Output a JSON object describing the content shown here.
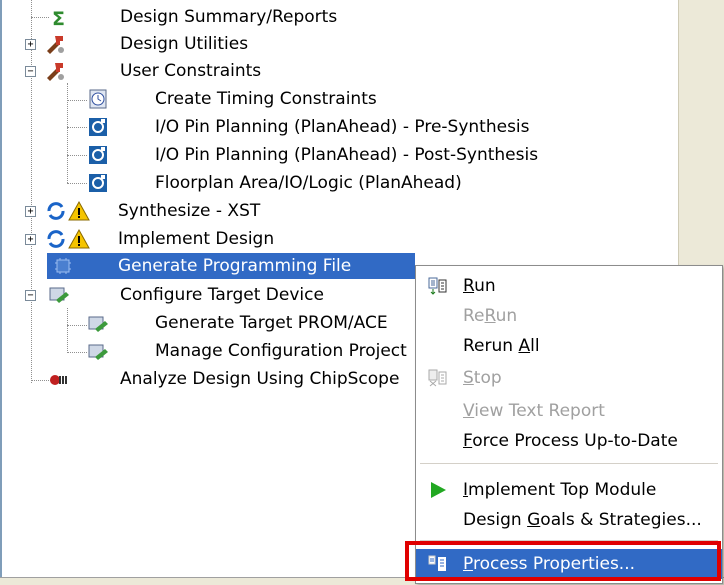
{
  "tree": {
    "items": [
      {
        "label": "Design Summary/Reports",
        "icon": "sigma-icon"
      },
      {
        "label": "Design Utilities",
        "icon": "tools-icon"
      },
      {
        "label": "User Constraints",
        "icon": "tools-icon"
      },
      {
        "label": "Create Timing Constraints",
        "icon": "clock-icon"
      },
      {
        "label": "I/O Pin Planning (PlanAhead) - Pre-Synthesis",
        "icon": "planahead-icon"
      },
      {
        "label": "I/O Pin Planning (PlanAhead) - Post-Synthesis",
        "icon": "planahead-icon"
      },
      {
        "label": "Floorplan Area/IO/Logic (PlanAhead)",
        "icon": "planahead-icon"
      },
      {
        "label": "Synthesize - XST",
        "icon": "refresh-warning-icon"
      },
      {
        "label": "Implement Design",
        "icon": "refresh-warning-icon"
      },
      {
        "label": "Generate Programming File",
        "icon": "chip-icon"
      },
      {
        "label": "Configure Target Device",
        "icon": "device-icon"
      },
      {
        "label": "Generate Target PROM/ACE",
        "icon": "device-icon"
      },
      {
        "label": "Manage Configuration Project",
        "icon": "device-icon"
      },
      {
        "label": "Analyze Design Using ChipScope",
        "icon": "chipscope-icon"
      }
    ]
  },
  "context_menu": {
    "items": [
      {
        "key": "run",
        "label": "Run",
        "mnemonic": "R",
        "rest": "un",
        "enabled": true,
        "icon": "run-icon"
      },
      {
        "key": "rerun",
        "label": "ReRun",
        "pre": "Re",
        "mnemonic": "R",
        "rest": "un",
        "enabled": false
      },
      {
        "key": "rerun_all",
        "pre": "Rerun ",
        "mnemonic": "A",
        "rest": "ll",
        "enabled": true
      },
      {
        "key": "stop",
        "mnemonic": "S",
        "rest": "top",
        "enabled": false,
        "icon": "stop-icon"
      },
      {
        "key": "view_text_report",
        "mnemonic": "V",
        "rest": "iew Text Report",
        "enabled": false
      },
      {
        "key": "force_process",
        "mnemonic": "F",
        "rest": "orce Process Up-to-Date",
        "enabled": true
      },
      {
        "key": "implement_top",
        "mnemonic": "I",
        "rest": "mplement Top Module",
        "enabled": true,
        "icon": "play-icon"
      },
      {
        "key": "design_goals",
        "pre": "Design ",
        "mnemonic": "G",
        "rest": "oals & Strategies...",
        "enabled": true
      },
      {
        "key": "process_properties",
        "mnemonic": "P",
        "rest": "rocess Properties...",
        "enabled": true,
        "icon": "properties-icon",
        "selected": true
      }
    ]
  },
  "colors": {
    "selection": "#316ac5",
    "highlight_box": "#e00000",
    "play": "#22a822"
  }
}
